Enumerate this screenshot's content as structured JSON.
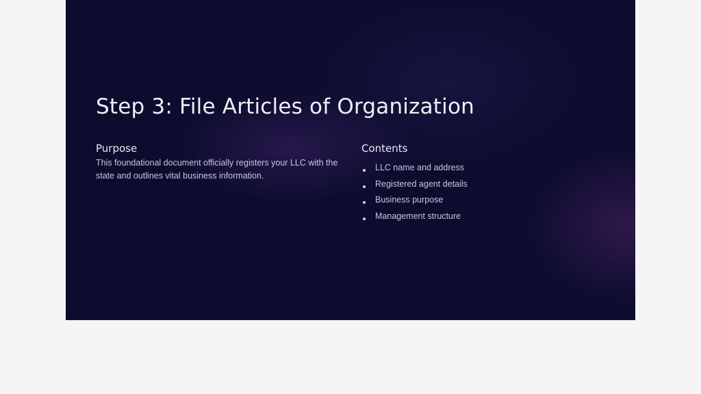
{
  "slide": {
    "title": "Step 3: File Articles of Organization",
    "purpose": {
      "heading": "Purpose",
      "body": "This foundational document officially registers your LLC with the state and outlines vital business information."
    },
    "contents": {
      "heading": "Contents",
      "items": [
        "LLC name and address",
        "Registered agent details",
        "Business purpose",
        "Management structure"
      ]
    },
    "colors": {
      "background": "#0c0c2e",
      "text": "#f1eff8",
      "muted_text": "#c9c7da"
    }
  }
}
